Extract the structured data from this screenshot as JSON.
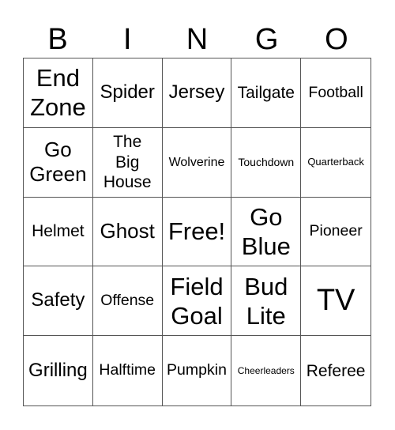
{
  "header": {
    "letters": [
      "B",
      "I",
      "N",
      "G",
      "O"
    ]
  },
  "board": {
    "rows": [
      [
        {
          "text": "End\nZone",
          "size": "xl"
        },
        {
          "text": "Spider",
          "size": "m"
        },
        {
          "text": "Jersey",
          "size": "m"
        },
        {
          "text": "Tailgate",
          "size": "ms"
        },
        {
          "text": "Football",
          "size": "s"
        }
      ],
      [
        {
          "text": "Go\nGreen",
          "size": "l"
        },
        {
          "text": "The\nBig\nHouse",
          "size": "ms"
        },
        {
          "text": "Wolverine",
          "size": "xs"
        },
        {
          "text": "Touchdown",
          "size": "xxs"
        },
        {
          "text": "Quarterback",
          "size": "xxxs"
        }
      ],
      [
        {
          "text": "Helmet",
          "size": "ms"
        },
        {
          "text": "Ghost",
          "size": "l"
        },
        {
          "text": "Free!",
          "size": "xl"
        },
        {
          "text": "Go\nBlue",
          "size": "xl"
        },
        {
          "text": "Pioneer",
          "size": "s"
        }
      ],
      [
        {
          "text": "Safety",
          "size": "m"
        },
        {
          "text": "Offense",
          "size": "s"
        },
        {
          "text": "Field\nGoal",
          "size": "xl"
        },
        {
          "text": "Bud\nLite",
          "size": "xl"
        },
        {
          "text": "TV",
          "size": "xxl"
        }
      ],
      [
        {
          "text": "Grilling",
          "size": "m"
        },
        {
          "text": "Halftime",
          "size": "s"
        },
        {
          "text": "Pumpkin",
          "size": "s"
        },
        {
          "text": "Cheerleaders",
          "size": "tiny"
        },
        {
          "text": "Referee",
          "size": "ms"
        }
      ]
    ]
  }
}
